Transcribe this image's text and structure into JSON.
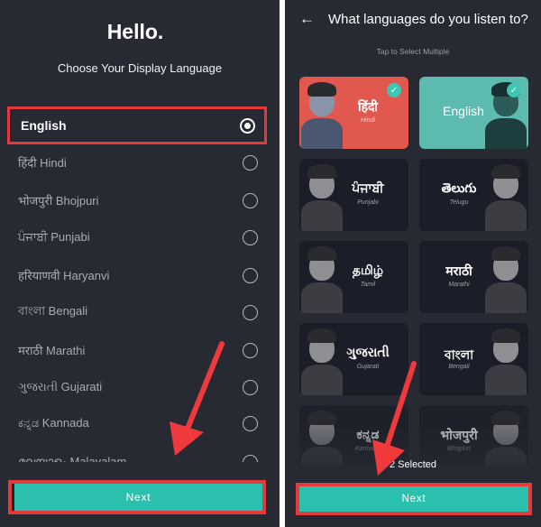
{
  "left_screen": {
    "title": "Hello.",
    "subtitle": "Choose Your Display Language",
    "languages": [
      {
        "label": "English",
        "selected": true
      },
      {
        "label": "हिंदी Hindi",
        "selected": false
      },
      {
        "label": "भोजपुरी Bhojpuri",
        "selected": false
      },
      {
        "label": "ਪੰਜਾਬੀ Punjabi",
        "selected": false
      },
      {
        "label": "हरियाणवी Haryanvi",
        "selected": false
      },
      {
        "label": "বাংলা Bengali",
        "selected": false
      },
      {
        "label": "मराठी Marathi",
        "selected": false
      },
      {
        "label": "ગુજરાતી Gujarati",
        "selected": false
      },
      {
        "label": "ಕನ್ನಡ Kannada",
        "selected": false
      },
      {
        "label": "മലയാളം Malayalam",
        "selected": false
      }
    ],
    "next_label": "Next"
  },
  "right_screen": {
    "back_icon": "arrow-left-icon",
    "title": "What languages do you listen to?",
    "hint": "Tap to Select Multiple",
    "cards": [
      {
        "native": "हिंदी",
        "english": "Hindi",
        "selected": true
      },
      {
        "native": "English",
        "english": "",
        "selected": true
      },
      {
        "native": "ਪੰਜਾਬੀ",
        "english": "Punjabi",
        "selected": false
      },
      {
        "native": "తెలుగు",
        "english": "Telugu",
        "selected": false
      },
      {
        "native": "தமிழ்",
        "english": "Tamil",
        "selected": false
      },
      {
        "native": "मराठी",
        "english": "Marathi",
        "selected": false
      },
      {
        "native": "ગુજરાતી",
        "english": "Gujarati",
        "selected": false
      },
      {
        "native": "বাংলা",
        "english": "Bengali",
        "selected": false
      },
      {
        "native": "ಕನ್ನಡ",
        "english": "Kannada",
        "selected": false
      },
      {
        "native": "भोजपुरी",
        "english": "Bhojpuri",
        "selected": false
      }
    ],
    "check_icon": "✓",
    "selected_count_text": "2 Selected",
    "next_label": "Next"
  },
  "colors": {
    "background": "#272a33",
    "accent_teal": "#2bbfae",
    "highlight_red": "#e6393c",
    "hindi_card": "#e1584f",
    "english_card": "#5dbaaf"
  }
}
